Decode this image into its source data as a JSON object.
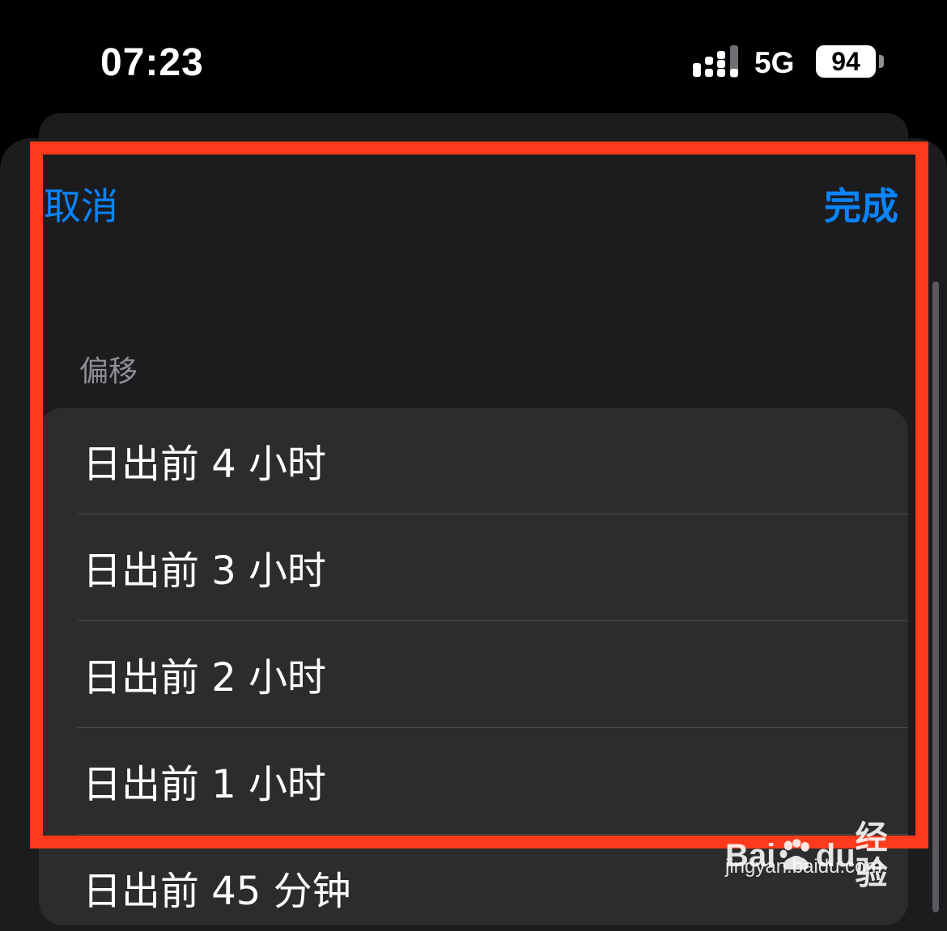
{
  "status_bar": {
    "time": "07:23",
    "network": "5G",
    "battery": "94"
  },
  "nav": {
    "cancel_label": "取消",
    "done_label": "完成"
  },
  "section": {
    "header": "偏移"
  },
  "options": [
    {
      "label": "日出前 4 小时"
    },
    {
      "label": "日出前 3 小时"
    },
    {
      "label": "日出前 2 小时"
    },
    {
      "label": "日出前 1 小时"
    },
    {
      "label": "日出前 45 分钟"
    }
  ],
  "watermark": {
    "brand_left": "Bai",
    "brand_right": "du",
    "product": "经验",
    "url": "jingyan.baidu.com"
  },
  "colors": {
    "accent": "#0a84ff",
    "highlight": "#fd3a1b",
    "sheet": "#1c1c1e",
    "cell": "#2c2c2e"
  }
}
